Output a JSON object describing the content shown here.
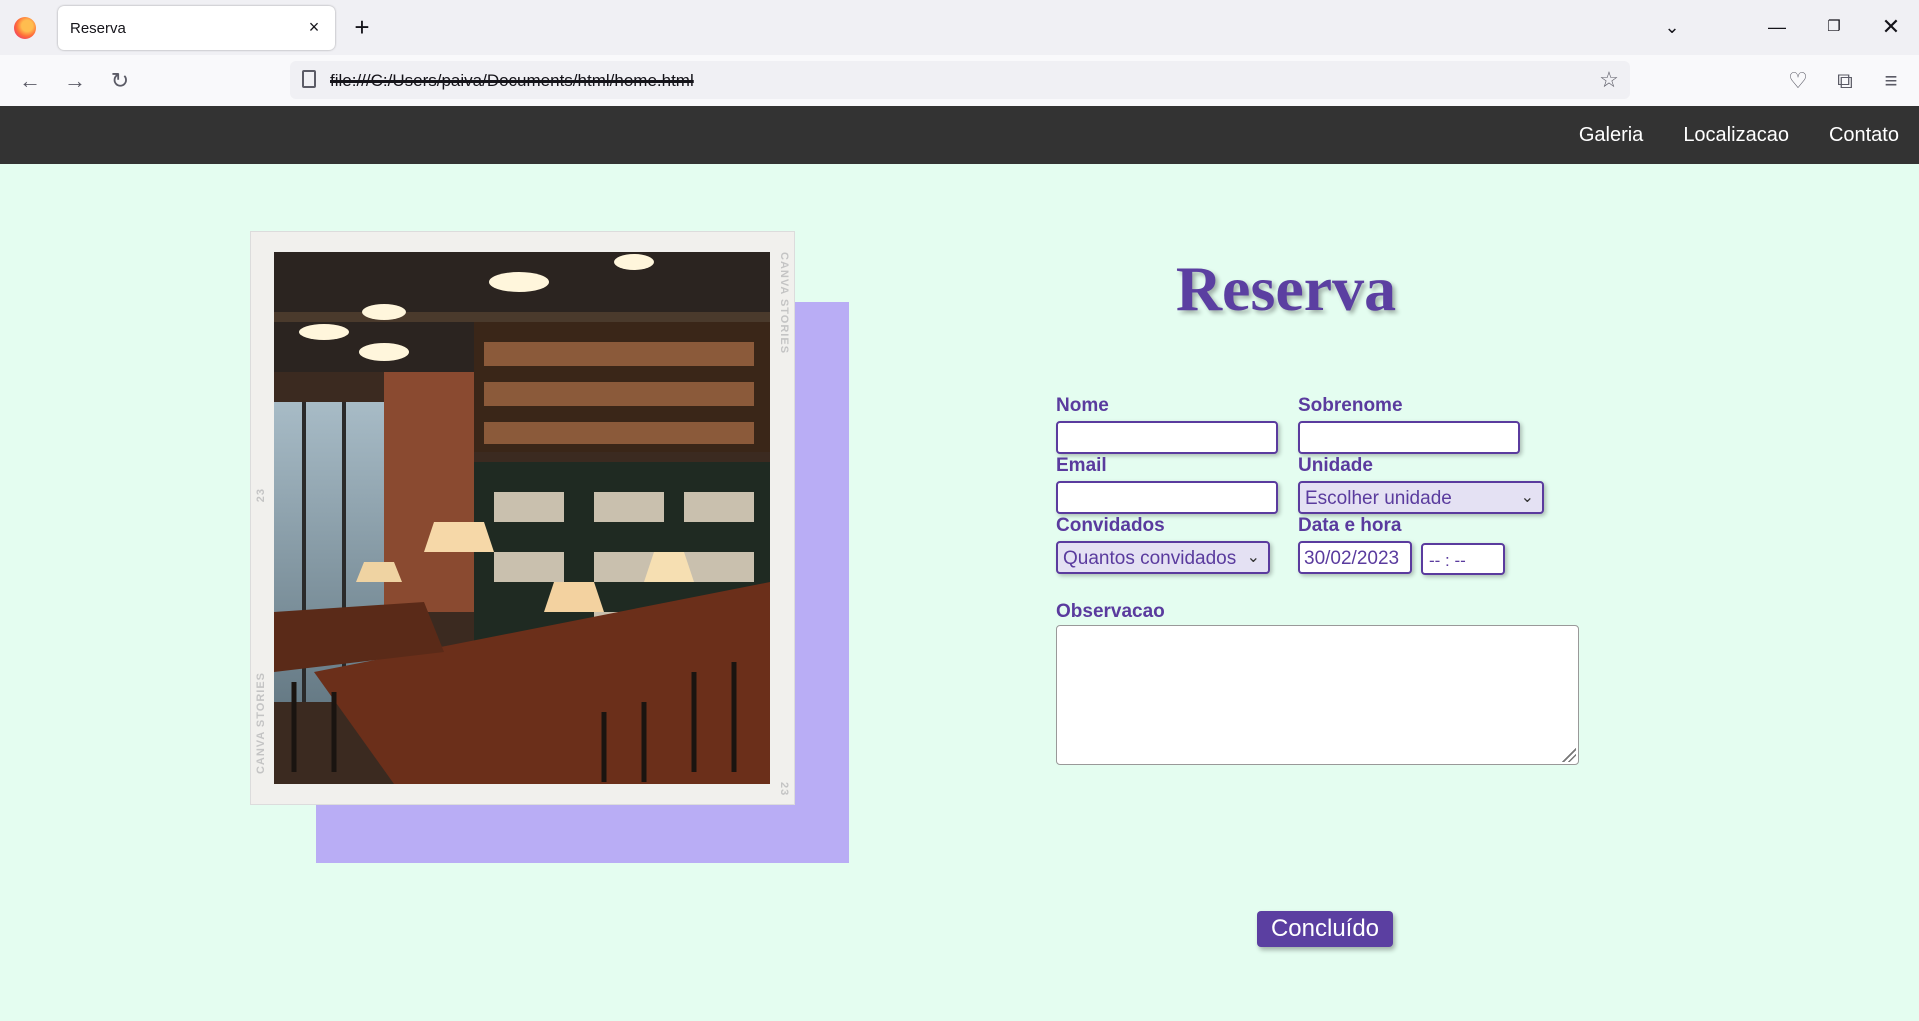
{
  "browser": {
    "tab_title": "Reserva",
    "tab_close": "×",
    "new_tab": "+",
    "url": "file:///C:/Users/paiva/Documents/html/home.html"
  },
  "site_nav": {
    "items": [
      "Galeria",
      "Localizacao",
      "Contato"
    ]
  },
  "form": {
    "title": "Reserva",
    "nome_label": "Nome",
    "sobrenome_label": "Sobrenome",
    "email_label": "Email",
    "unidade_label": "Unidade",
    "unidade_value": "Escolher unidade",
    "convidados_label": "Convidados",
    "convidados_value": "Quantos convidados",
    "data_label": "Data e hora",
    "date_value": "30/02/2023",
    "time_value": "-- : --",
    "observacao_label": "Observacao",
    "submit_label": "Concluído"
  },
  "photo": {
    "frame_text_top": "CANVA STORIES",
    "frame_text_bottom": "CANVA STORIES",
    "frame_number": "23"
  },
  "colors": {
    "page_bg": "#e4fdf0",
    "header_bg": "#333333",
    "accent": "#5b3fa1",
    "photo_shadow": "#b9adf5"
  }
}
